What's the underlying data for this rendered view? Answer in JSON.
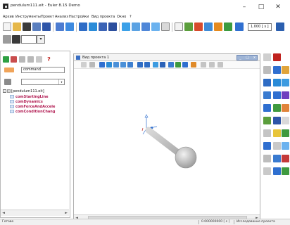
{
  "window": {
    "title": "pendulum111.eit - Euler 8.15 Demo",
    "minimize": "–",
    "maximize": "□",
    "close": "✕"
  },
  "menu": [
    "Архив",
    "Инструменты",
    "Проект",
    "Анализ",
    "Настройки",
    "Вид проекта",
    "Окно",
    "?"
  ],
  "toolbar": {
    "time_value": "1.000 [ s ]"
  },
  "left_panel": {
    "command_value": "command",
    "tree": {
      "root": "[pendulum111.eit]",
      "children": [
        "comStartingLine",
        "comDynamics",
        "comForceAndAccele",
        "comConditionChang"
      ]
    },
    "scroll_left": "◄",
    "scroll_right": "►"
  },
  "project_window": {
    "title": "Вид проекта 1",
    "ctrl_min": "_",
    "ctrl_max": "□",
    "ctrl_close": "x",
    "scroll_left": "◄",
    "scroll_right": "►"
  },
  "status": {
    "left": "Готово",
    "time": "0.000000000 [ s ]",
    "right": "Исследование проекта"
  },
  "colors": {
    "accent_blue": "#2f6fd0",
    "pendulum_gray": "#bdbdbd",
    "tree_text": "#b0174f"
  }
}
